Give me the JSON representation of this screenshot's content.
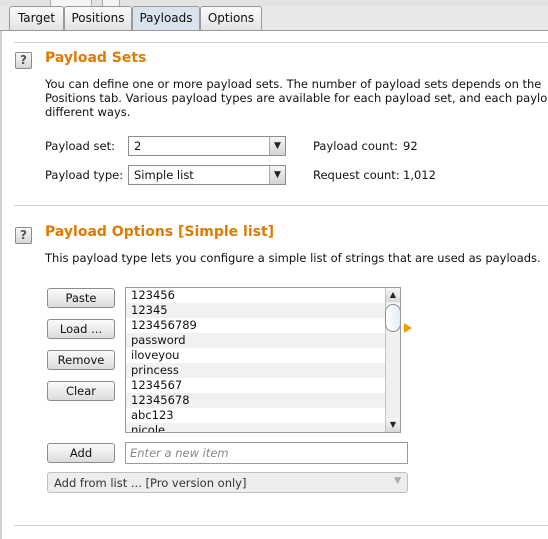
{
  "tabs": [
    {
      "label": "Target"
    },
    {
      "label": "Positions"
    },
    {
      "label": "Payloads"
    },
    {
      "label": "Options"
    }
  ],
  "payload_sets": {
    "heading": "Payload Sets",
    "help_glyph": "?",
    "description_lines": [
      "You can define one or more payload sets. The number of payload sets depends on the",
      "Positions tab. Various payload types are available for each payload set, and each payloa",
      "different ways."
    ],
    "set_label": "Payload set:",
    "set_value": "2",
    "type_label": "Payload type:",
    "type_value": "Simple list",
    "count_label": "Payload count:",
    "count_value": "92",
    "request_label": "Request count:",
    "request_value": "1,012"
  },
  "payload_options": {
    "heading": "Payload Options [Simple list]",
    "help_glyph": "?",
    "description": "This payload type lets you configure a simple list of strings that are used as payloads.",
    "buttons": {
      "paste": "Paste",
      "load": "Load ...",
      "remove": "Remove",
      "clear": "Clear",
      "add": "Add"
    },
    "list_items": [
      "123456",
      "12345",
      "123456789",
      "password",
      "iloveyou",
      "princess",
      "1234567",
      "12345678",
      "abc123",
      "nicole"
    ],
    "new_item_placeholder": "Enter a new item",
    "add_from_list": "Add from list ... [Pro version only]"
  },
  "icons": {
    "dropdown": "chevron-down-icon",
    "scroll_up": "scroll-up-arrow-icon",
    "scroll_down": "scroll-down-arrow-icon",
    "expand": "expand-arrow-icon"
  },
  "colors": {
    "heading": "#e07b00",
    "expand_arrow": "#e8a000",
    "active_tab": "#d8e3ee"
  }
}
